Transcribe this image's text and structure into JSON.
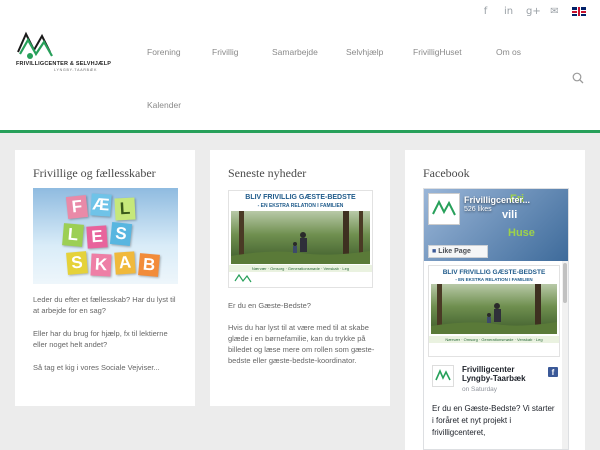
{
  "header": {
    "logo": {
      "name": "FRIVILLIGCENTER & SELVHJÆLP",
      "sub": "LYNGBY-TAARBÆK"
    },
    "nav": [
      {
        "label": "Forening"
      },
      {
        "label": "Frivillig"
      },
      {
        "label": "Samarbejde"
      },
      {
        "label": "Selvhjælp"
      },
      {
        "label": "FrivilligHuset"
      },
      {
        "label": "Om os"
      },
      {
        "label": "Kalender"
      }
    ],
    "social_icons": [
      "facebook-icon",
      "linkedin-icon",
      "google-plus-icon",
      "email-icon",
      "uk-flag-icon"
    ]
  },
  "cards": [
    {
      "title": "Frivillige og fællesskaber",
      "image_letters": [
        "F",
        "Æ",
        "L",
        "L",
        "E",
        "S",
        "S",
        "K",
        "A",
        "B"
      ],
      "paragraphs": [
        "Leder du efter et fællesskab? Har du lyst til at arbejde for en sag?",
        "Eller har du brug for hjælp, fx til lektierne eller noget helt andet?",
        "Så tag et kig i vores Sociale Vejviser..."
      ]
    },
    {
      "title": "Seneste nyheder",
      "image": {
        "headline": "BLIV FRIVILLIG GÆSTE-BEDSTE",
        "subheadline": "- EN EKSTRA RELATION I FAMILIEN",
        "band": "Nærvær · Omsorg · Generationsmøde · Venskab · Leg"
      },
      "paragraphs": [
        "Er du en Gæste-Bedste?",
        "Hvis du har lyst til at være med til at skabe glæde i en børnefamilie, kan du trykke på billedet og læse mere om rollen som gæste-bedste eller gæste-bedste-koordinator."
      ]
    },
    {
      "title": "Facebook",
      "fb": {
        "page_name": "Frivilligcenter...",
        "likes": "526 likes",
        "like_button": "Like Page",
        "post_page_name": "Frivilligcenter Lyngby-Taarbæk",
        "post_time": "on Saturday",
        "post_text": "Er du en Gæste-Bedste? Vi starter i foråret et nyt projekt i frivilligcenteret,"
      }
    }
  ],
  "colors": {
    "accent": "#27a05a",
    "nav_text": "#8a8a8a",
    "facebook": "#3b5998"
  }
}
